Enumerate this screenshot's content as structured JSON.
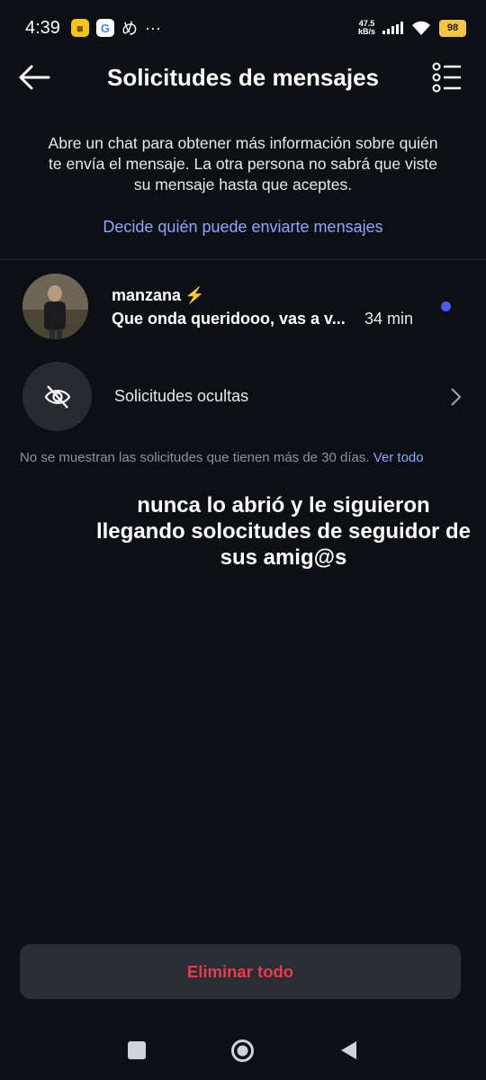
{
  "status_bar": {
    "time": "4:39",
    "app_icon_google": "G",
    "extra_glyph": "め",
    "more": "···",
    "net_speed_value": "47.5",
    "net_speed_unit": "kB/s",
    "battery": "98"
  },
  "header": {
    "title": "Solicitudes de mensajes"
  },
  "info": {
    "text": "Abre un chat para obtener más información sobre quién te envía el mensaje. La otra persona no sabrá que viste su mensaje hasta que aceptes.",
    "link": "Decide quién puede enviarte mensajes"
  },
  "request": {
    "name": "manzana",
    "emoji": "⚡",
    "preview": "Que onda queridooo, vas a v...",
    "time": "34 min"
  },
  "hidden_requests": {
    "label": "Solicitudes ocultas"
  },
  "note": {
    "text": "No se muestran las solicitudes que tienen más de 30 días.",
    "link": "Ver todo"
  },
  "overlay_caption": "nunca lo abrió y le siguieron llegando solocitudes de seguidor de sus amig@s",
  "footer": {
    "delete_all": "Eliminar todo"
  },
  "colors": {
    "background": "#0c0f14",
    "link": "#8fa5ff",
    "danger": "#f0394c",
    "unread": "#4a5cff"
  }
}
